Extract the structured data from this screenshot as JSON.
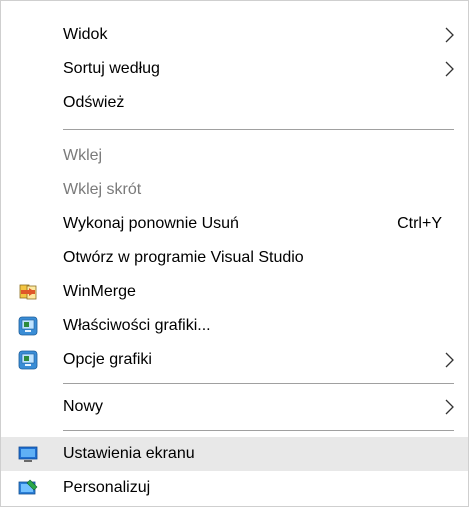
{
  "menu": {
    "items": [
      {
        "label": "Widok",
        "submenu": true
      },
      {
        "label": "Sortuj według",
        "submenu": true
      },
      {
        "label": "Odśwież"
      },
      {
        "label": "Wklej",
        "disabled": true
      },
      {
        "label": "Wklej skrót",
        "disabled": true
      },
      {
        "label": "Wykonaj ponownie Usuń",
        "shortcut": "Ctrl+Y"
      },
      {
        "label": "Otwórz w programie Visual Studio"
      },
      {
        "label": "WinMerge",
        "icon": "winmerge-icon"
      },
      {
        "label": "Właściwości grafiki...",
        "icon": "intel-graphics-icon"
      },
      {
        "label": "Opcje grafiki",
        "icon": "intel-graphics-icon",
        "submenu": true
      },
      {
        "label": "Nowy",
        "submenu": true
      },
      {
        "label": "Ustawienia ekranu",
        "icon": "display-icon",
        "highlighted": true
      },
      {
        "label": "Personalizuj",
        "icon": "personalize-icon"
      }
    ]
  },
  "colors": {
    "highlight": "#e8e8e8",
    "disabled_text": "#7a7a7a",
    "separator": "#a0a0a0",
    "border": "#cfcfcf"
  }
}
